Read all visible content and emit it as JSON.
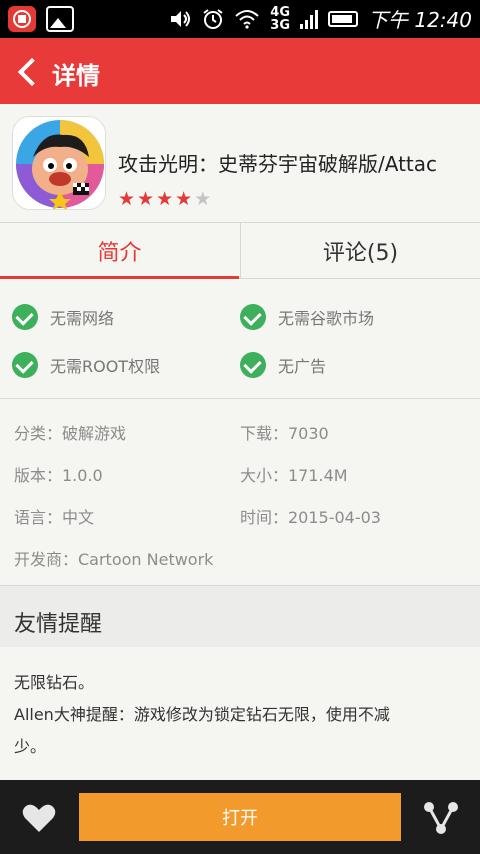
{
  "status_bar": {
    "app_badge": "",
    "network_top": "4G",
    "network_bottom": "3G",
    "time": "下午 12:40"
  },
  "header": {
    "title": "详情"
  },
  "app": {
    "name": "攻击光明：史蒂芬宇宙破解版/Attac",
    "rating": 4,
    "rating_max": 5
  },
  "tabs": [
    {
      "label": "简介"
    },
    {
      "label": "评论(5)"
    }
  ],
  "features": [
    {
      "label": "无需网络"
    },
    {
      "label": "无需谷歌市场"
    },
    {
      "label": "无需ROOT权限"
    },
    {
      "label": "无广告"
    }
  ],
  "info": {
    "category": "分类：破解游戏",
    "downloads": "下载：7030",
    "version": "版本：1.0.0",
    "size": "大小：171.4M",
    "language": "语言：中文",
    "date": "时间：2015-04-03",
    "developer": "开发商：Cartoon Network"
  },
  "reminder": {
    "title": "友情提醒",
    "line1": "无限钻石。",
    "line2": "Allen大神提醒：游戏修改为锁定钻石无限，使用不减",
    "line3": "少。"
  },
  "bottom": {
    "open_label": "打开"
  },
  "colors": {
    "header_red": "#e93a3a",
    "accent_red": "#e53935",
    "check_green": "#3cb05a",
    "open_orange": "#f39a2c"
  }
}
